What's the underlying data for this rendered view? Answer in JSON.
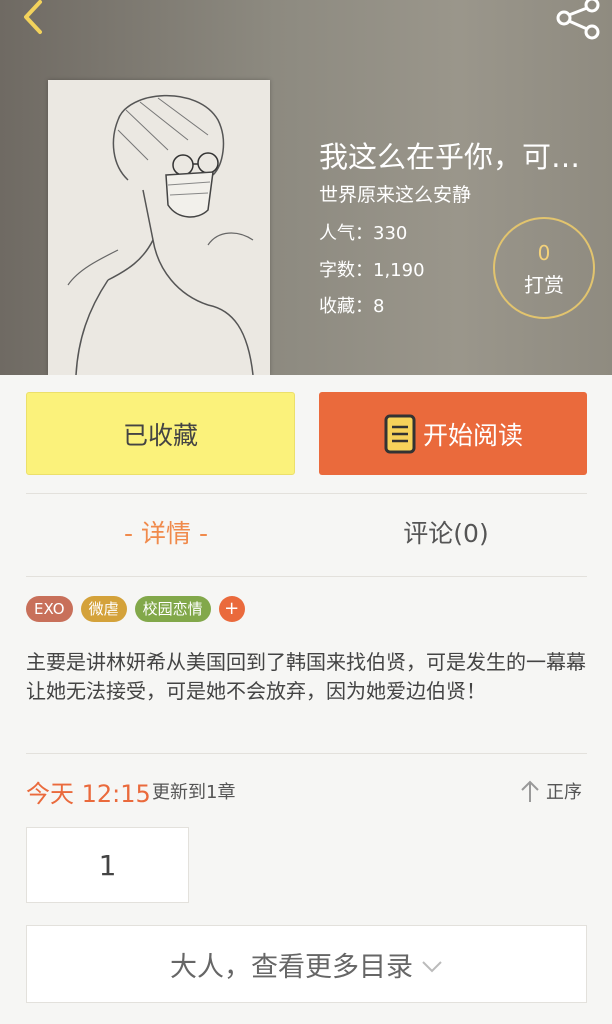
{
  "book": {
    "title": "我这么在乎你，可…",
    "author": "世界原来这么安静",
    "popularity": "人气：330",
    "word_count": "字数：1,190",
    "favorites": "收藏：8"
  },
  "reward": {
    "count": "0",
    "label": "打赏"
  },
  "actions": {
    "favorited_label": "已收藏",
    "read_label": "开始阅读"
  },
  "tabs": {
    "detail": "- 详情 -",
    "comments": "评论(0)"
  },
  "tags": [
    {
      "label": "EXO",
      "color": "#c8705a"
    },
    {
      "label": "微虐",
      "color": "#d4a23a"
    },
    {
      "label": "校园恋情",
      "color": "#82a84a"
    }
  ],
  "tag_add": "+",
  "summary": "主要是讲林妍希从美国回到了韩国来找伯贤，可是发生的一幕幕让她无法接受，可是她不会放弃，因为她爱边伯贤！",
  "update": {
    "time": "今天 12:15",
    "text": "更新到1章",
    "sort_label": "正序"
  },
  "chapter": {
    "number": "1"
  },
  "more": {
    "label": "大人，查看更多目录"
  },
  "colors": {
    "accent": "#ea6a3c",
    "favorited_bg": "#fbf27b",
    "tab_active": "#f08a4b",
    "reward_ring": "#e2c46e"
  },
  "icons": [
    "back-arrow-icon",
    "share-icon",
    "book-icon",
    "sort-up-icon",
    "chevron-down-icon"
  ]
}
